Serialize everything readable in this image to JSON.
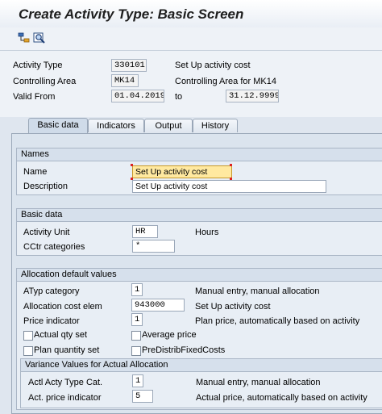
{
  "window": {
    "title": "Create Activity Type: Basic Screen"
  },
  "toolbar": {
    "icons": [
      "hierarchy-icon",
      "find-icon"
    ]
  },
  "header": {
    "activity_type": {
      "label": "Activity Type",
      "value": "330101",
      "desc": "Set Up activity cost"
    },
    "controlling_area": {
      "label": "Controlling Area",
      "value": "MK14",
      "desc": "Controlling Area for MK14"
    },
    "valid_from": {
      "label": "Valid From",
      "value": "01.04.2019",
      "to_label": "to",
      "to_value": "31.12.9999"
    }
  },
  "tabs": [
    {
      "label": "Basic data",
      "active": true
    },
    {
      "label": "Indicators",
      "active": false
    },
    {
      "label": "Output",
      "active": false
    },
    {
      "label": "History",
      "active": false
    }
  ],
  "names": {
    "title": "Names",
    "name": {
      "label": "Name",
      "value": "Set Up activity cost"
    },
    "description": {
      "label": "Description",
      "value": "Set Up activity cost"
    }
  },
  "basic_data": {
    "title": "Basic data",
    "activity_unit": {
      "label": "Activity Unit",
      "value": "HR",
      "desc": "Hours"
    },
    "cctr_categories": {
      "label": "CCtr categories",
      "value": "*"
    }
  },
  "allocation": {
    "title": "Allocation default values",
    "atyp_category": {
      "label": "ATyp category",
      "value": "1",
      "desc": "Manual entry, manual allocation"
    },
    "alloc_cost_elem": {
      "label": "Allocation cost elem",
      "value": "943000",
      "desc": "Set Up activity cost"
    },
    "price_indicator": {
      "label": "Price indicator",
      "value": "1",
      "desc": "Plan price, automatically based on activity"
    },
    "actual_qty_set": {
      "label": "Actual qty set",
      "checked": false
    },
    "average_price": {
      "label": "Average price",
      "checked": false
    },
    "plan_quantity_set": {
      "label": "Plan quantity set",
      "checked": false
    },
    "predistrib": {
      "label": "PreDistribFixedCosts",
      "checked": false
    }
  },
  "variance": {
    "title": "Variance Values for Actual Allocation",
    "actl_acty_type_cat": {
      "label": "Actl Acty Type Cat.",
      "value": "1",
      "desc": "Manual entry, manual allocation"
    },
    "act_price_indicator": {
      "label": "Act. price indicator",
      "value": "5",
      "desc": "Actual price, automatically based on activity"
    }
  },
  "colors": {
    "focus_field": "#ffe9a0",
    "panel": "#dbe4ee",
    "group": "#e8eef5"
  }
}
